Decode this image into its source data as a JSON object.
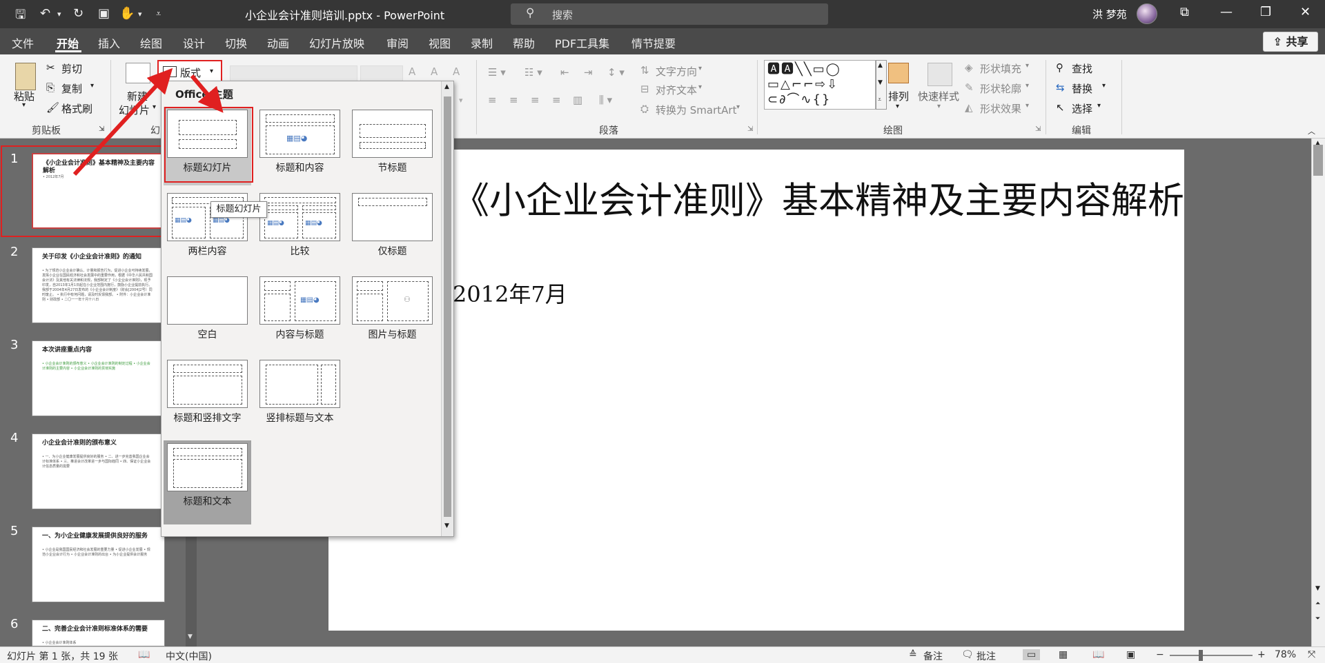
{
  "app": {
    "doc_title": "小企业会计准则培训.pptx  -  PowerPoint",
    "search_placeholder": "搜索",
    "user_name": "洪 梦苑",
    "share_label": "共享"
  },
  "menu_tabs": [
    "文件",
    "开始",
    "插入",
    "绘图",
    "设计",
    "切换",
    "动画",
    "幻灯片放映",
    "审阅",
    "视图",
    "录制",
    "帮助",
    "PDF工具集",
    "情节提要"
  ],
  "ribbon": {
    "paste": "粘贴",
    "cut": "剪切",
    "copy": "复制",
    "format_painter": "格式刷",
    "clipboard_group": "剪贴板",
    "new_slide_1": "新建",
    "new_slide_2": "幻灯片",
    "layout": "版式",
    "slides_group": "幻",
    "text_direction": "文字方向",
    "align_text": "对齐文本",
    "convert_smartart": "转换为 SmartArt",
    "paragraph_group": "段落",
    "arrange": "排列",
    "quick_styles": "快速样式",
    "shape_fill": "形状填充",
    "shape_outline": "形状轮廓",
    "shape_effects": "形状效果",
    "drawing_group": "绘图",
    "find": "查找",
    "replace": "替换",
    "select": "选择",
    "editing_group": "编辑"
  },
  "layout_gallery": {
    "header": "Office 主题",
    "items": [
      "标题幻灯片",
      "标题和内容",
      "节标题",
      "两栏内容",
      "比较",
      "仅标题",
      "空白",
      "内容与标题",
      "图片与标题",
      "标题和竖排文字",
      "竖排标题与文本",
      "标题和文本"
    ],
    "tooltip": "标题幻灯片"
  },
  "slides": [
    {
      "num": "1",
      "title": "《小企业会计准则》基本精神及主要内容解析",
      "body": "• 2012年7月"
    },
    {
      "num": "2",
      "title": "关于印发《小企业会计准则》的通知",
      "body": "• 为了规范小企业会计确认、计量和报告行为，促进小企业可持续发展，发挥小企业在国民经济和社会发展中的重要作用，根据《中华人民共和国会计法》及其他有关法律和法规，我部制定了《小企业会计准则》，现予印发，自2013年1月1日起在小企业范围内施行，鼓励小企业提前执行。我部于2004年4月27日发布的《小企业会计制度》（财会[2004]2号）同时废止。 • 执行中有何问题，请及时反馈我部。 • 附件：小企业会计准则 • 财政部 • 二〇一一年十月十八日"
    },
    {
      "num": "3",
      "title": "本次讲座重点内容",
      "body": "• 小企业会计准则的颁布意义 • 小企业会计准则的制定过程 • 小企业会计准则的主要内容 • 小企业会计准则的贯彻实施"
    },
    {
      "num": "4",
      "title": "小企业会计准则的颁布意义",
      "body": "• 一、为小企业健康发展提供良好的服务 • 二、进一步完善我国企业会计标准体系 • 三、推进会计改革进一步与国际趋同 • 四、保证小企业会计信息质量的需要"
    },
    {
      "num": "5",
      "title": "一、为小企业健康发展提供良好的服务",
      "body": "• 小企业是我国国民经济和社会发展的重要力量 • 促进小企业发展 • 规范小企业会计行为 • 小企业会计准则的出台 • 为小企业提供会计服务"
    },
    {
      "num": "6",
      "title": "二、完善企业会计准则标准体系的需要",
      "body": "• 小企业会计准则体系"
    }
  ],
  "main_slide": {
    "title": "《小企业会计准则》基本精神及主要内容解析",
    "subtitle": "2012年7月"
  },
  "status": {
    "slide_info": "幻灯片 第 1 张，共 19 张",
    "language": "中文(中国)",
    "notes": "备注",
    "comments": "批注",
    "zoom": "78%"
  }
}
